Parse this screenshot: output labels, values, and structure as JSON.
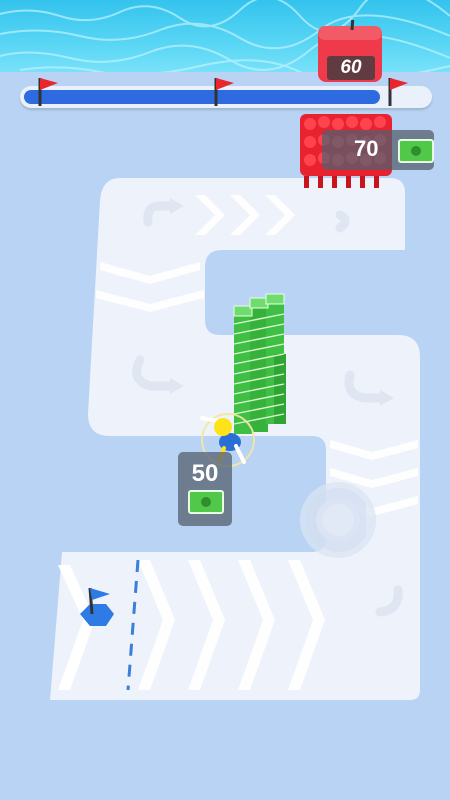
{
  "level_progress": {
    "fraction": 0.88,
    "flags": [
      "start-flag",
      "checkpoint-flag",
      "finish-flag"
    ],
    "colors": {
      "fill": "#2e6be0",
      "track": "#eaf1fb",
      "flag": "#e8262c"
    }
  },
  "enemy_tower": {
    "count": "60",
    "color": "#ee3a4a"
  },
  "enemy_crowd": {
    "price": "70",
    "color": "#e8232f"
  },
  "player_gate": {
    "price": "50"
  },
  "cash_stack": {
    "columns": 3,
    "color": "#3fbf43"
  },
  "player": {
    "color": "#ffe21a",
    "outfit": "#2a6fd6"
  },
  "home_base": {
    "color": "#2e7be6"
  },
  "water_color": "#3ec9f0",
  "ground_color": "#b9d3f4",
  "path_color": "#eef2fa"
}
